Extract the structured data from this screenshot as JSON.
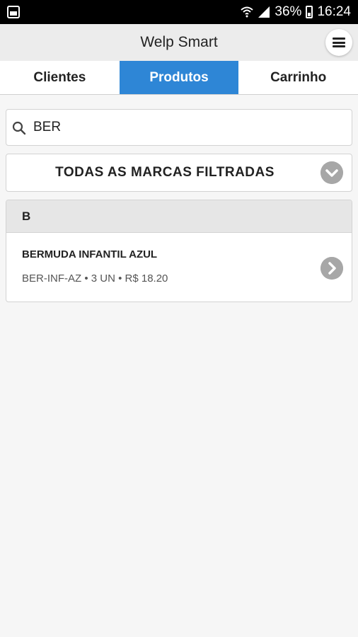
{
  "status_bar": {
    "battery_percent": "36%",
    "time": "16:24",
    "icons": [
      "gallery-icon",
      "wifi-icon",
      "signal-icon",
      "battery-icon"
    ]
  },
  "app": {
    "title": "Welp Smart"
  },
  "tabs": [
    {
      "label": "Clientes",
      "active": false
    },
    {
      "label": "Produtos",
      "active": true
    },
    {
      "label": "Carrinho",
      "active": false
    }
  ],
  "search": {
    "value": "BER"
  },
  "brand_filter": {
    "label": "TODAS AS MARCAS FILTRADAS"
  },
  "product_list": {
    "sections": [
      {
        "letter": "B",
        "items": [
          {
            "name": "BERMUDA INFANTIL AZUL",
            "meta": "BER-INF-AZ • 3 UN • R$ 18.20"
          }
        ]
      }
    ]
  },
  "colors": {
    "accent": "#2e86d6",
    "status_bar": "#000000",
    "app_bar": "#ececec",
    "chevron_bg": "#a7a7a7"
  }
}
